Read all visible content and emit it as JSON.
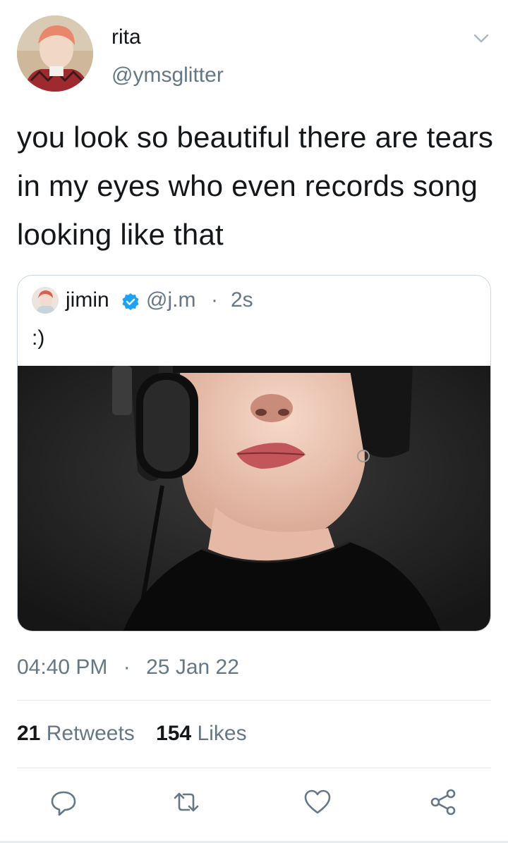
{
  "author": {
    "name": "rita",
    "handle": "@ymsglitter"
  },
  "tweet": {
    "text": "you look so beautiful there are tears in my eyes who even records song looking like that"
  },
  "quoted": {
    "name": "jimin",
    "handle": "@j.m",
    "separator": "·",
    "time": "2s",
    "text": ":)"
  },
  "meta": {
    "time": "04:40 PM",
    "separator": "·",
    "date": "25 Jan 22",
    "retweets_count": "21",
    "retweets_label": "Retweets",
    "likes_count": "154",
    "likes_label": "Likes"
  },
  "icons": [
    "chevron-down-icon",
    "verified-badge-icon",
    "reply-icon",
    "retweet-icon",
    "like-icon",
    "share-icon"
  ],
  "colors": {
    "text": "#14171a",
    "secondary": "#657786",
    "verified": "#1da1f2",
    "divider": "#e1e8ed"
  }
}
